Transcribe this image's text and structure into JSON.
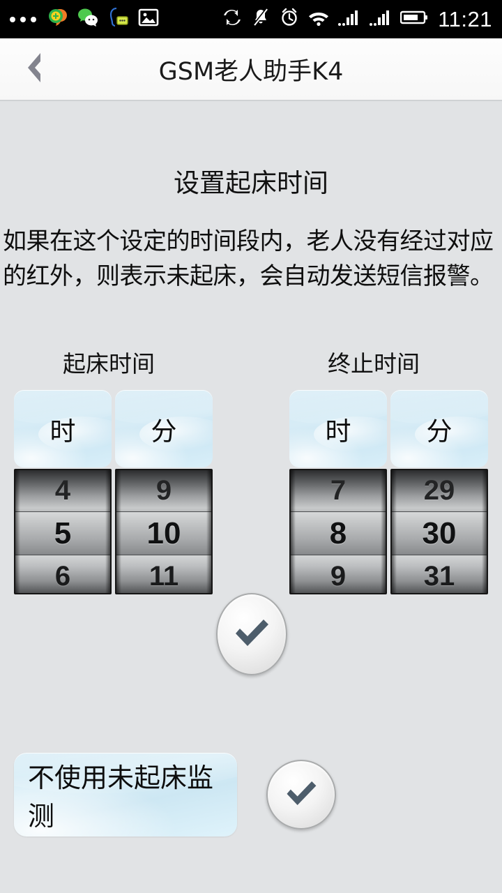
{
  "statusbar": {
    "time": "11:21",
    "left_icons": [
      {
        "name": "more-dots-icon"
      },
      {
        "name": "phone-app-icon"
      },
      {
        "name": "wechat-icon"
      },
      {
        "name": "message-bubble-icon"
      },
      {
        "name": "gallery-image-icon"
      }
    ],
    "right_icons": [
      {
        "name": "sync-icon"
      },
      {
        "name": "bell-muted-icon"
      },
      {
        "name": "alarm-clock-icon"
      },
      {
        "name": "wifi-icon"
      },
      {
        "name": "signal-bars-sim1-icon"
      },
      {
        "name": "signal-bars-sim2-icon"
      },
      {
        "name": "battery-icon"
      }
    ]
  },
  "titlebar": {
    "back_icon": "chevron-left-icon",
    "title": "GSM老人助手K4"
  },
  "main": {
    "heading": "设置起床时间",
    "description": "如果在这个设定的时间段内，老人没有经过对应的红外，则表示未起床，会自动发送短信报警。",
    "start_group": {
      "label": "起床时间",
      "hour": {
        "header": "时",
        "prev": "4",
        "current": "5",
        "next": "6"
      },
      "minute": {
        "header": "分",
        "prev": "9",
        "current": "10",
        "next": "11"
      }
    },
    "end_group": {
      "label": "终止时间",
      "hour": {
        "header": "时",
        "prev": "7",
        "current": "8",
        "next": "9"
      },
      "minute": {
        "header": "分",
        "prev": "29",
        "current": "30",
        "next": "31"
      }
    },
    "confirm_time_button": {
      "icon": "checkmark-icon"
    },
    "disable_row": {
      "label": "不使用未起床监测",
      "confirm_icon": "checkmark-icon"
    }
  },
  "colors": {
    "page_background": "#e1e3e5",
    "statusbar_background": "#000000",
    "titlebar_background": "#fafafa",
    "panel_blue": "#d4ecf6",
    "checkmark": "#4a5a68",
    "text_primary": "#101010"
  }
}
